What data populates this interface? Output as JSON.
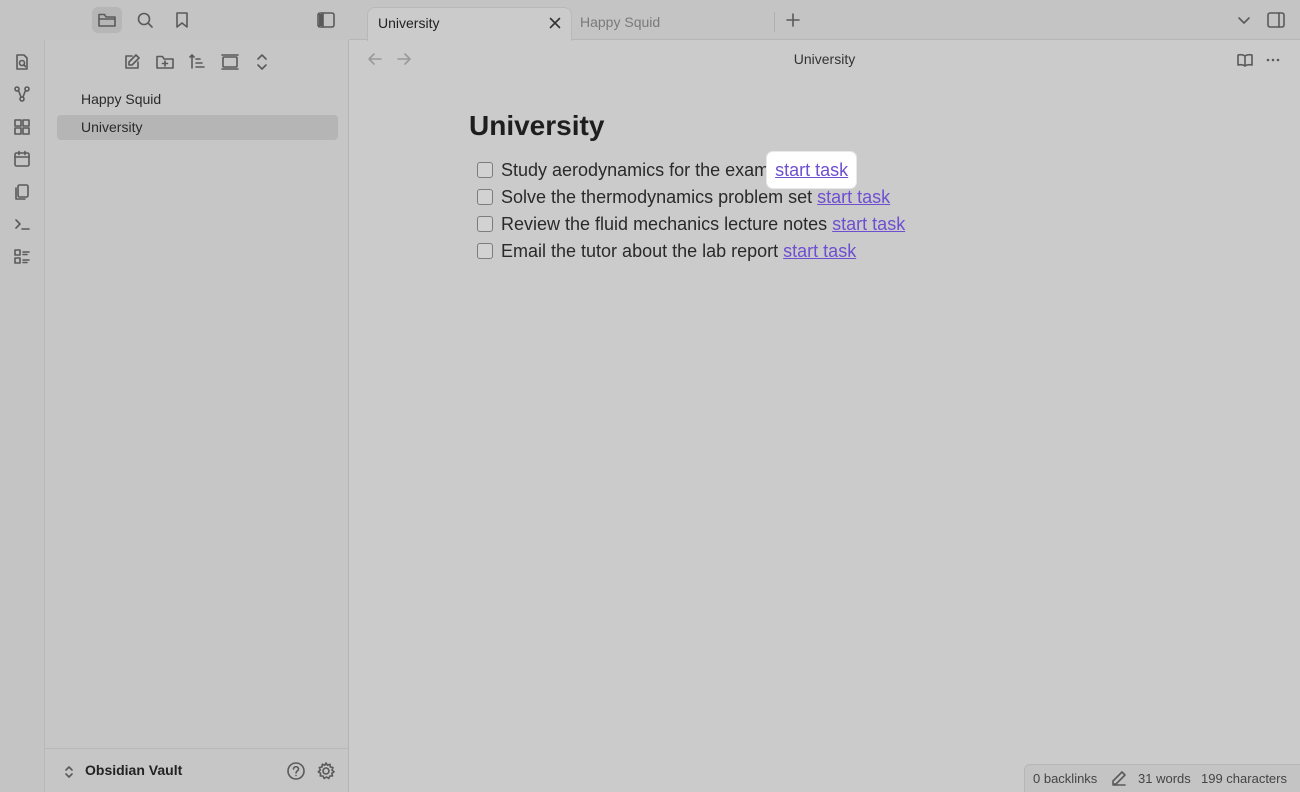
{
  "titlebar": {
    "files_icon": "folder-icon",
    "search_icon": "search-icon",
    "bookmarks_icon": "bookmark-icon",
    "sidebar_toggle_icon": "sidebar-left-icon"
  },
  "ribbon": {
    "items": [
      "open-quick-switcher-icon",
      "graph-view-icon",
      "canvas-icon",
      "daily-note-icon",
      "templates-icon",
      "command-palette-icon",
      "tasks-icon"
    ]
  },
  "sidebar": {
    "nav_icons": [
      "new-note-icon",
      "new-folder-icon",
      "sort-icon",
      "collapse-icon",
      "expand-icon"
    ],
    "files": [
      {
        "label": "Happy Squid",
        "active": false
      },
      {
        "label": "University",
        "active": true
      }
    ],
    "vault_name": "Obsidian Vault"
  },
  "tabs": [
    {
      "label": "University",
      "active": true
    },
    {
      "label": "Happy Squid",
      "active": false
    }
  ],
  "header": {
    "title": "University"
  },
  "note": {
    "title": "University",
    "tasks": [
      {
        "text": "Study aerodynamics for the exam",
        "link": "start task"
      },
      {
        "text": "Solve the thermodynamics problem set",
        "link": "start task"
      },
      {
        "text": "Review the fluid mechanics lecture notes",
        "link": "start task"
      },
      {
        "text": "Email the tutor about the lab report",
        "link": "start task"
      }
    ]
  },
  "status": {
    "backlinks": "0 backlinks",
    "words": "31 words",
    "characters": "199 characters"
  },
  "colors": {
    "link": "#6d4fd0",
    "background": "#cbcbcb"
  }
}
